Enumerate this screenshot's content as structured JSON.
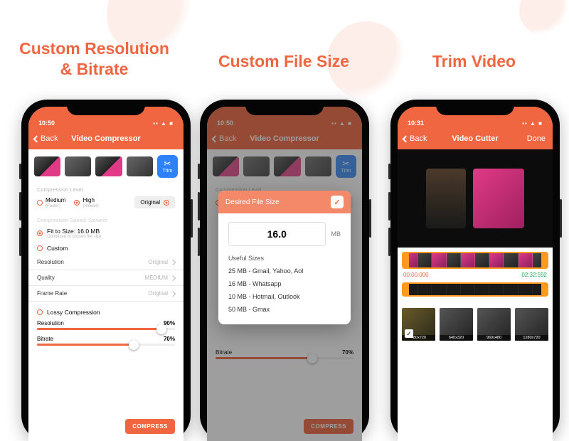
{
  "headlines": {
    "p1_l1": "Custom Resolution",
    "p1_l2": "& Bitrate",
    "p2": "Custom File Size",
    "p3": "Trim Video"
  },
  "status_icons": "▪▪ ▲ ■",
  "screen1": {
    "time": "10:50",
    "back": "Back",
    "title": "Video Compressor",
    "trim": "Trim",
    "compression_level_label": "Compression Level",
    "opt_medium": "Medium",
    "opt_medium_sub": "(Faster)",
    "opt_high": "High",
    "opt_high_sub": "(Slower)",
    "opt_original": "Original",
    "speed_label": "Compression Speed: Slowest",
    "fit_label": "Fit to Size: 16.0 MB",
    "fit_sub": "Optimized to chosen file size",
    "custom_label": "Custom",
    "rows": {
      "resolution_k": "Resolution",
      "resolution_v": "Original",
      "quality_k": "Quality",
      "quality_v": "MEDIUM",
      "framerate_k": "Frame Rate",
      "framerate_v": "Original"
    },
    "lossy_label": "Lossy Compression",
    "slider_resolution_label": "Resolution",
    "slider_resolution_val": "90%",
    "slider_resolution_pct": 90,
    "slider_bitrate_label": "Bitrate",
    "slider_bitrate_val": "70%",
    "slider_bitrate_pct": 70,
    "compress_btn": "COMPRESS"
  },
  "screen2": {
    "time": "10:50",
    "back": "Back",
    "title": "Video Compressor",
    "modal_title": "Desired File Size",
    "size_value": "16.0",
    "size_unit": "MB",
    "useful_header": "Useful Sizes",
    "useful_items": [
      "25 MB - Gmail, Yahoo, Aol",
      "16 MB - Whatsapp",
      "10 MB - Hotmail, Outlook",
      "50 MB - Gmax"
    ],
    "bitrate_label": "Bitrate",
    "bitrate_val": "70%"
  },
  "screen3": {
    "time": "10:31",
    "back": "Back",
    "title": "Video Cutter",
    "done": "Done",
    "t_start": "00:00:000",
    "t_end": "02:32:592",
    "clips": [
      {
        "label": "480x720",
        "selected": true
      },
      {
        "label": "640x320",
        "selected": false
      },
      {
        "label": "960x480",
        "selected": false
      },
      {
        "label": "1280x720",
        "selected": false
      }
    ]
  }
}
